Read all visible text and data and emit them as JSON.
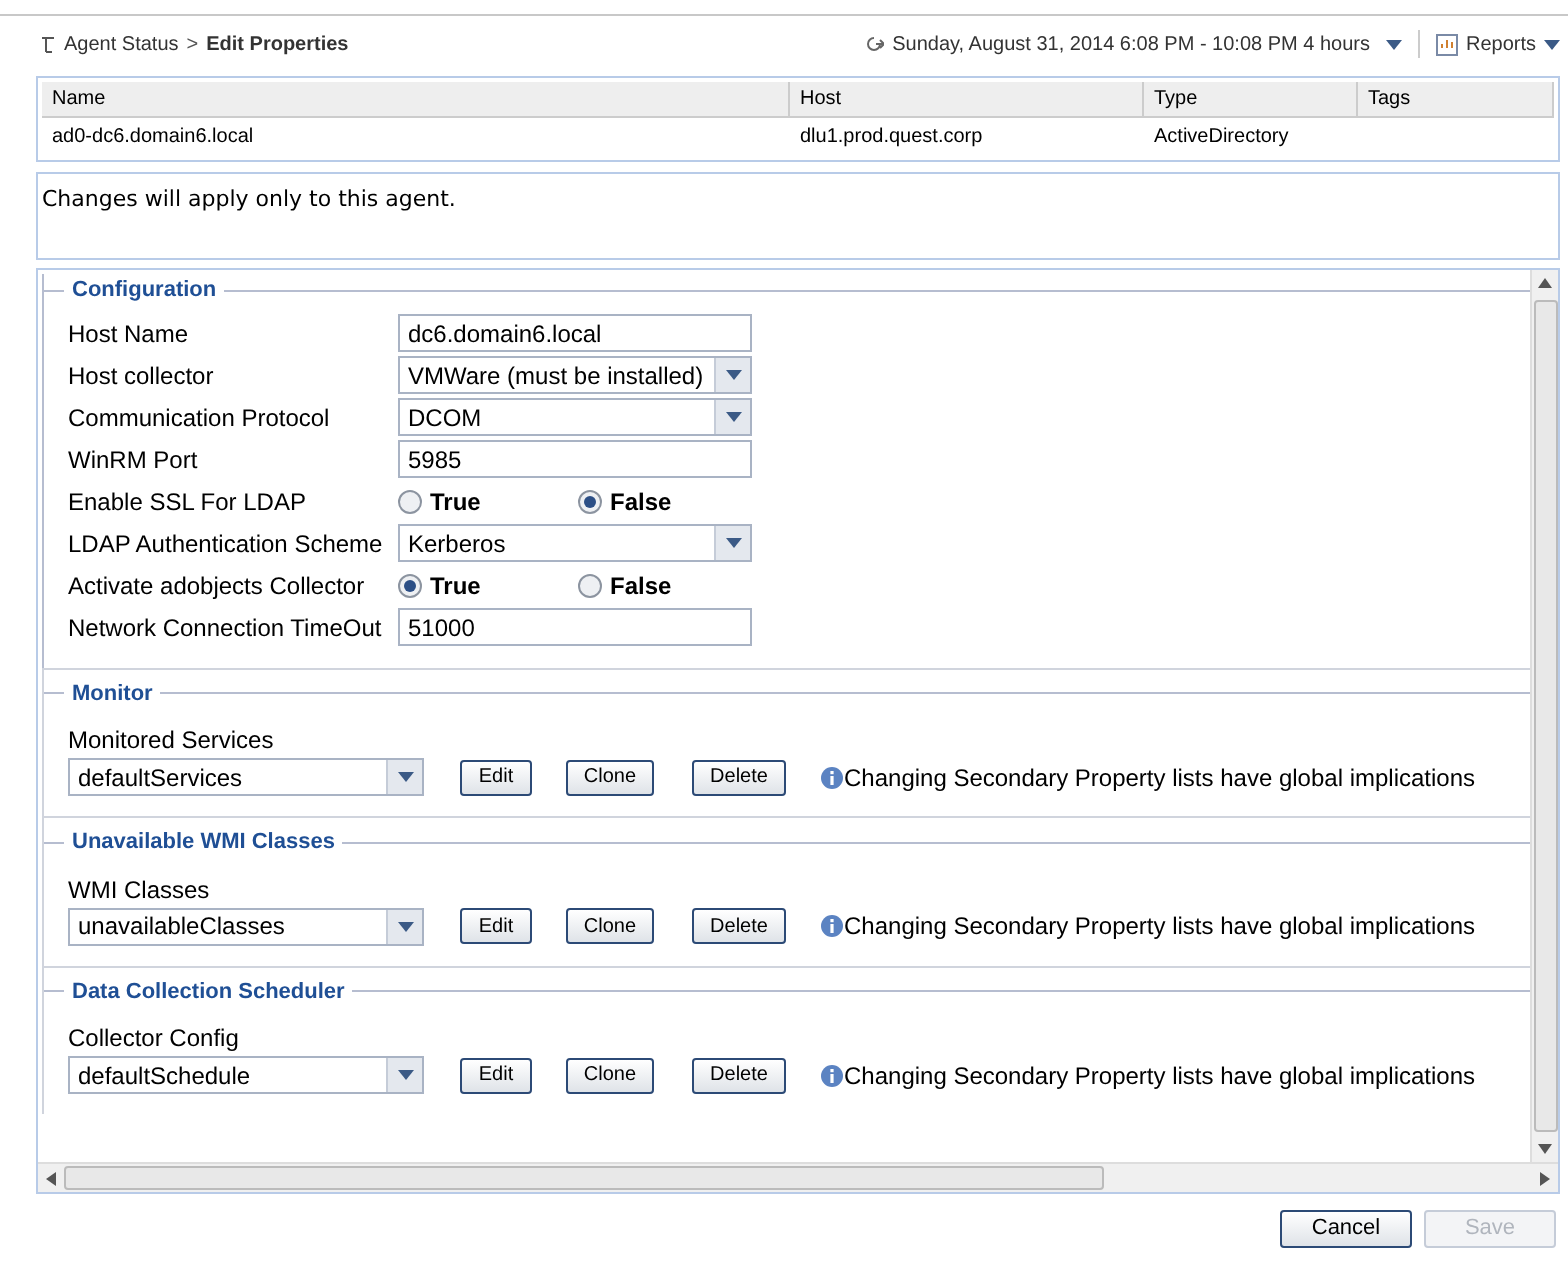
{
  "breadcrumb": {
    "parent": "Agent Status",
    "separator": ">",
    "current": "Edit Properties"
  },
  "time_range": {
    "label": "Sunday, August 31, 2014 6:08 PM - 10:08 PM 4 hours"
  },
  "reports": {
    "label": "Reports"
  },
  "table": {
    "columns": [
      "Name",
      "Host",
      "Type",
      "Tags"
    ],
    "rows": [
      [
        "ad0-dc6.domain6.local",
        "dlu1.prod.quest.corp",
        "ActiveDirectory",
        ""
      ]
    ]
  },
  "message": "Changes will apply only to this agent.",
  "configuration": {
    "title": "Configuration",
    "fields": [
      {
        "kind": "text",
        "label": "Host Name",
        "value": "dc6.domain6.local"
      },
      {
        "kind": "select",
        "label": "Host collector",
        "value": "VMWare (must be installed)"
      },
      {
        "kind": "select",
        "label": "Communication Protocol",
        "value": "DCOM"
      },
      {
        "kind": "text",
        "label": "WinRM Port",
        "value": "5985"
      },
      {
        "kind": "radio",
        "label": "Enable SSL For LDAP",
        "options": [
          {
            "label": "True",
            "selected": false
          },
          {
            "label": "False",
            "selected": true
          }
        ]
      },
      {
        "kind": "select",
        "label": "LDAP Authentication Scheme",
        "value": "Kerberos"
      },
      {
        "kind": "radio",
        "label": "Activate adobjects Collector",
        "options": [
          {
            "label": "True",
            "selected": true
          },
          {
            "label": "False",
            "selected": false
          }
        ]
      },
      {
        "kind": "text",
        "label": "Network Connection TimeOut",
        "value": "51000"
      }
    ]
  },
  "sections": [
    {
      "title": "Monitor",
      "label": "Monitored Services",
      "value": "defaultServices",
      "buttons": [
        "Edit",
        "Clone",
        "Delete"
      ],
      "note": "Changing Secondary Property lists have global implications"
    },
    {
      "title": "Unavailable WMI Classes",
      "label": "WMI Classes",
      "value": "unavailableClasses",
      "buttons": [
        "Edit",
        "Clone",
        "Delete"
      ],
      "note": "Changing Secondary Property lists have global implications"
    },
    {
      "title": "Data Collection Scheduler",
      "label": "Collector Config",
      "value": "defaultSchedule",
      "buttons": [
        "Edit",
        "Clone",
        "Delete"
      ],
      "note": "Changing Secondary Property lists have global implications"
    }
  ],
  "footer_buttons": [
    {
      "label": "Cancel",
      "disabled": false
    },
    {
      "label": "Save",
      "disabled": true
    }
  ]
}
